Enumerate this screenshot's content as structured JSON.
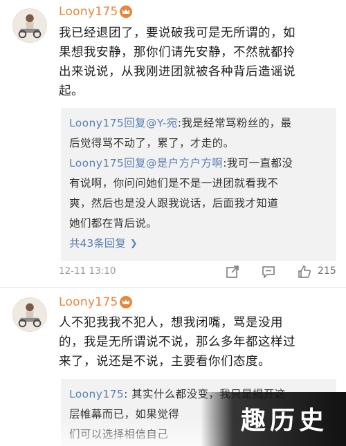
{
  "comments": [
    {
      "username": "Loony175",
      "badge_icon": "crown-badge-icon",
      "avatar_icon": "avatar-girl-motorcycle-icon",
      "text": "我已经退团了，要说破我可是无所谓的，如\n果想我安静，那你们请先安静，不然就都拎\n出来说说，从我刚进团就被各种背后造谣说\n起。",
      "replies": [
        {
          "user": "Loony175",
          "reply_to": "回复@Y-宛",
          "text": ":我是经常骂粉丝的，最\n后觉得骂不动了，累了，才走的。"
        },
        {
          "user": "Loony175",
          "reply_to": "回复@是户方户方啊",
          "text": ":我可一直都没\n有说啊，你问问她们是不是一进团就看我不\n爽，然后也是没人跟我说话，后面我才知道\n她们都在背后说。"
        }
      ],
      "more_replies": "共43条回复",
      "timestamp": "12-11 13:10",
      "likes": "215"
    },
    {
      "username": "Loony175",
      "badge_icon": "crown-badge-icon",
      "avatar_icon": "avatar-girl-motorcycle-icon",
      "text": "人不犯我我不犯人，想我闭嘴，骂是没用\n的，我是无所谓说不说，那么多年都这样过\n来了，说还是不说，主要看你们态度。",
      "replies": [
        {
          "user": "Loony175",
          "reply_to": "",
          "text": ": 其实什么都没变，我只是揭开这\n层帷幕而已，如果觉得\n们可以选择相信自己"
        }
      ]
    }
  ],
  "watermark": "趣历史",
  "colors": {
    "username": "#e9853a",
    "link": "#5b7fb3",
    "reply_bg": "#f2f2f2"
  }
}
